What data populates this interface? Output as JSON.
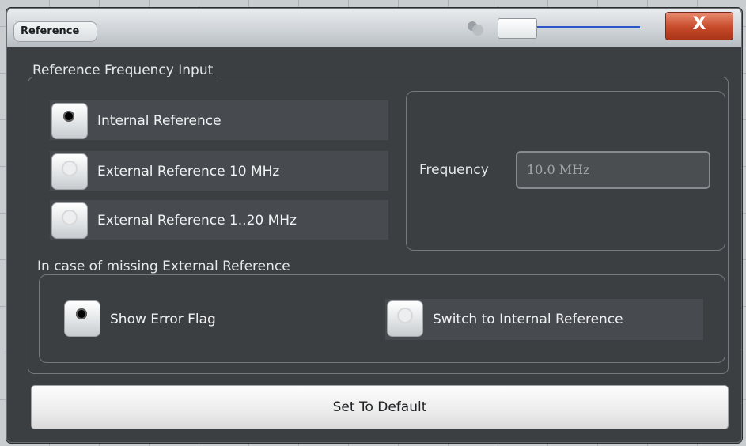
{
  "window": {
    "title": "Reference",
    "close_label": "X",
    "transparency_slider_value": 0
  },
  "reference_input": {
    "section_label": "Reference Frequency Input",
    "options": [
      {
        "label": "Internal Reference",
        "selected": true
      },
      {
        "label": "External Reference 10 MHz",
        "selected": false
      },
      {
        "label": "External Reference 1..20 MHz",
        "selected": false
      }
    ],
    "frequency_label": "Frequency",
    "frequency_value": "10.0 MHz"
  },
  "missing_reference": {
    "section_label": "In case of missing External Reference",
    "options": [
      {
        "label": "Show Error Flag",
        "selected": true
      },
      {
        "label": "Switch to Internal Reference",
        "selected": false
      }
    ]
  },
  "actions": {
    "set_default_label": "Set To Default"
  },
  "colors": {
    "dialog_bg": "#3b3f42",
    "close_button": "#c64a2a",
    "slider_accent": "#2b55c9"
  }
}
